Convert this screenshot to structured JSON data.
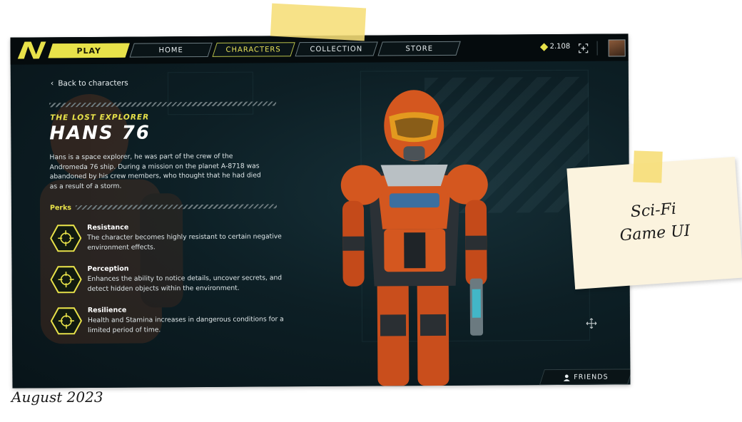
{
  "nav": {
    "play": "PLAY",
    "home": "HOME",
    "characters": "CHARACTERS",
    "collection": "COLLECTION",
    "store": "STORE"
  },
  "currency": {
    "amount": "2.108",
    "icon": "diamond-icon"
  },
  "back_link": "Back to characters",
  "character": {
    "subtitle": "THE LOST EXPLORER",
    "name": "HANS 76",
    "description": "Hans is a space explorer, he was part of the crew of the Andromeda 76 ship. During a mission on the planet A-8718 was abandoned by his crew members, who thought that he had died as a result of a storm."
  },
  "perks": {
    "label": "Perks",
    "items": [
      {
        "name": "Resistance",
        "description": "The character becomes highly resistant to certain negative environment effects."
      },
      {
        "name": "Perception",
        "description": "Enhances the ability to notice details, uncover secrets, and detect hidden objects within the environment."
      },
      {
        "name": "Resilience",
        "description": "Health and Stamina increases in dangerous conditions for a limited period of time."
      }
    ]
  },
  "friends_button": "FRIENDS",
  "note": {
    "line1": "Sci-Fi",
    "line2": "Game UI"
  },
  "date_caption": "August 2023",
  "colors": {
    "accent": "#e8e24a",
    "background": "#0b1a1f",
    "armor": "#d4571f"
  }
}
